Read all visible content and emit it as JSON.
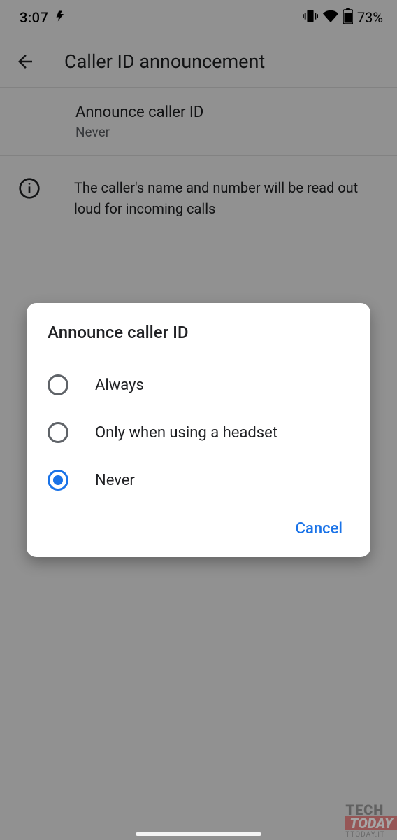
{
  "statusbar": {
    "time": "3:07",
    "battery_pct": "73%"
  },
  "header": {
    "title": "Caller ID announcement"
  },
  "setting": {
    "title": "Announce caller ID",
    "value": "Never"
  },
  "info": {
    "text": "The caller's name and number will be read out loud for incoming calls"
  },
  "dialog": {
    "title": "Announce caller ID",
    "options": [
      {
        "label": "Always",
        "selected": false
      },
      {
        "label": "Only when using a headset",
        "selected": false
      },
      {
        "label": "Never",
        "selected": true
      }
    ],
    "cancel": "Cancel"
  },
  "watermark": {
    "line1": "TECH",
    "line2": "TODAY",
    "url": "TTODAY.IT"
  }
}
